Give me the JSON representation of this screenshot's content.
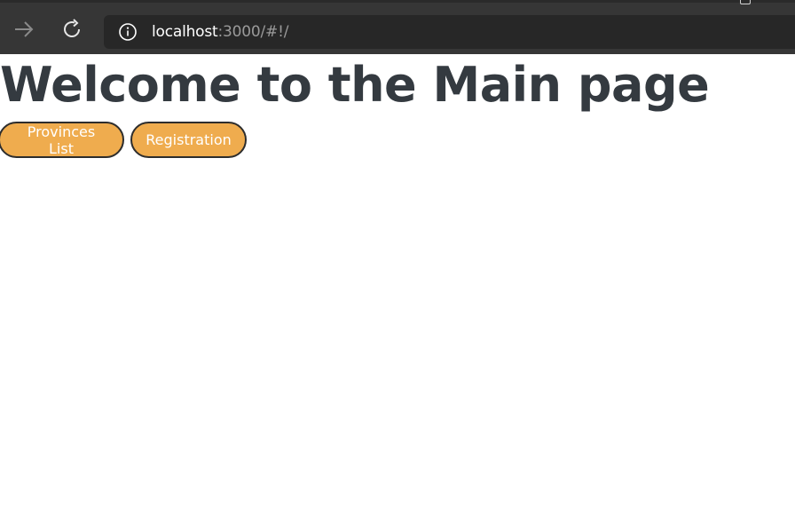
{
  "browser": {
    "url_host": "localhost",
    "url_rest": ":3000/#!/"
  },
  "main": {
    "title": "Welcome to the Main page",
    "buttons": [
      {
        "label": "Provinces List"
      },
      {
        "label": "Registration"
      }
    ]
  },
  "colors": {
    "button_bg": "#efac4e",
    "heading": "#343a40",
    "chrome_bg": "#363636"
  }
}
